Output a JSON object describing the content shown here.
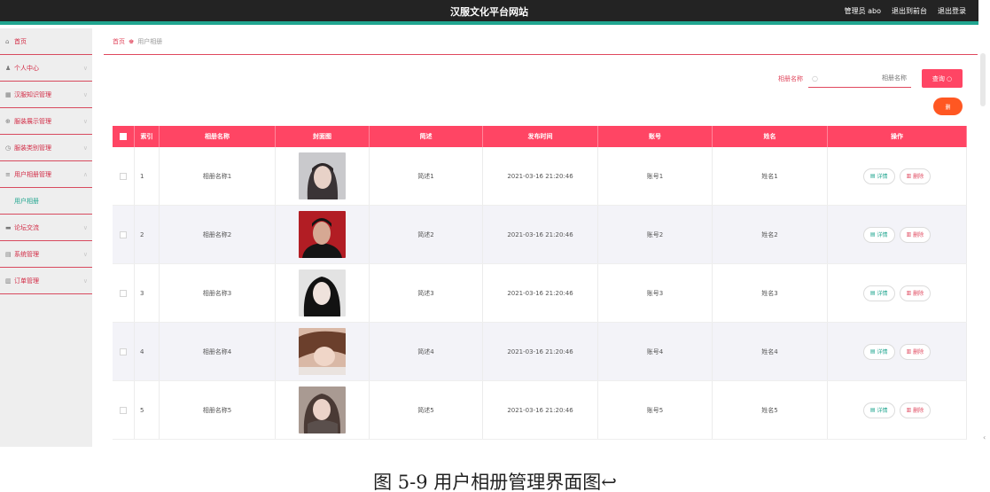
{
  "header": {
    "site_title": "汉服文化平台网站",
    "admin_label": "管理员 abo",
    "back_to_front": "退出到前台",
    "logout": "退出登录"
  },
  "sidebar": {
    "items": [
      {
        "label": "首页",
        "icon": "home-icon"
      },
      {
        "label": "个人中心",
        "icon": "user-icon"
      },
      {
        "label": "汉服知识管理",
        "icon": "grid-icon"
      },
      {
        "label": "服装展示管理",
        "icon": "settings-icon"
      },
      {
        "label": "服装类别管理",
        "icon": "clock-icon"
      },
      {
        "label": "用户相册管理",
        "icon": "list-icon"
      },
      {
        "label": "用户相册",
        "icon": ""
      },
      {
        "label": "论坛交流",
        "icon": "chat-icon"
      },
      {
        "label": "系统管理",
        "icon": "system-icon"
      },
      {
        "label": "订单管理",
        "icon": "order-icon"
      }
    ]
  },
  "breadcrumb": {
    "home": "首页",
    "current": "用户相册"
  },
  "search": {
    "label": "相册名称",
    "placeholder": "相册名称",
    "button": "查询"
  },
  "batch_delete": "删",
  "table": {
    "headers": [
      "索引",
      "相册名称",
      "封面图",
      "简述",
      "发布时间",
      "账号",
      "姓名",
      "操作"
    ],
    "rows": [
      {
        "index": "1",
        "name": "相册名称1",
        "desc": "简述1",
        "time": "2021-03-16 21:20:46",
        "account": "账号1",
        "real_name": "姓名1"
      },
      {
        "index": "2",
        "name": "相册名称2",
        "desc": "简述2",
        "time": "2021-03-16 21:20:46",
        "account": "账号2",
        "real_name": "姓名2"
      },
      {
        "index": "3",
        "name": "相册名称3",
        "desc": "简述3",
        "time": "2021-03-16 21:20:46",
        "account": "账号3",
        "real_name": "姓名3"
      },
      {
        "index": "4",
        "name": "相册名称4",
        "desc": "简述4",
        "time": "2021-03-16 21:20:46",
        "account": "账号4",
        "real_name": "姓名4"
      },
      {
        "index": "5",
        "name": "相册名称5",
        "desc": "简述5",
        "time": "2021-03-16 21:20:46",
        "account": "账号5",
        "real_name": "姓名5"
      }
    ],
    "detail_label": "详情",
    "delete_label": "删除"
  },
  "caption": "图 5-9 用户相册管理界面图↩",
  "colors": {
    "accent": "#ff4564",
    "teal": "#20a58f",
    "topbar": "#232323",
    "batch_delete": "#ff5722"
  }
}
